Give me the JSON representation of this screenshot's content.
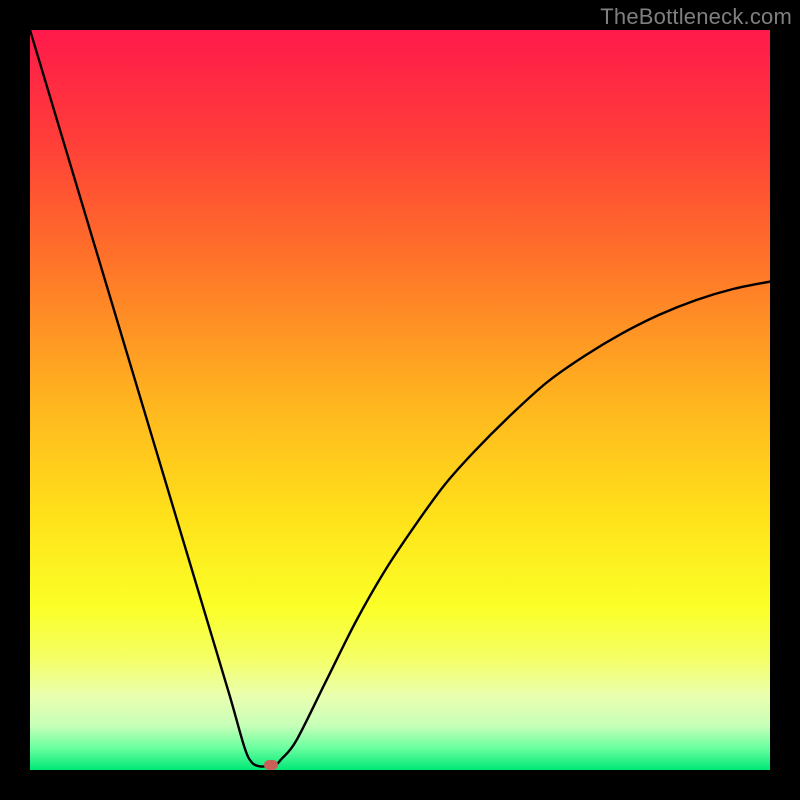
{
  "watermark": "TheBottleneck.com",
  "chart_data": {
    "type": "line",
    "title": "",
    "xlabel": "",
    "ylabel": "",
    "xlim": [
      0,
      100
    ],
    "ylim": [
      0,
      100
    ],
    "grid": false,
    "legend": false,
    "series": [
      {
        "name": "bottleneck-curve",
        "x": [
          0,
          3,
          6,
          9,
          12,
          15,
          18,
          21,
          24,
          27,
          29,
          30,
          31,
          32,
          33,
          34,
          36,
          40,
          44,
          48,
          52,
          56,
          60,
          65,
          70,
          75,
          80,
          85,
          90,
          95,
          100
        ],
        "y": [
          100,
          90,
          80,
          70,
          60,
          50,
          40,
          30,
          20,
          10,
          3,
          1,
          0.5,
          0.5,
          0.5,
          1.5,
          4,
          12,
          20,
          27,
          33,
          38.5,
          43,
          48,
          52.5,
          56,
          59,
          61.5,
          63.5,
          65,
          66
        ]
      }
    ],
    "marker": {
      "x": 32.5,
      "y": 0.7,
      "color": "#c86058"
    },
    "gradient_stops": [
      {
        "pct": 0,
        "color": "#ff1a4b"
      },
      {
        "pct": 14,
        "color": "#ff3b3a"
      },
      {
        "pct": 30,
        "color": "#ff6f2a"
      },
      {
        "pct": 50,
        "color": "#ffb41f"
      },
      {
        "pct": 66,
        "color": "#ffe21a"
      },
      {
        "pct": 78,
        "color": "#fbff27"
      },
      {
        "pct": 85,
        "color": "#f4ff66"
      },
      {
        "pct": 90,
        "color": "#eaffb0"
      },
      {
        "pct": 94,
        "color": "#c7ffb8"
      },
      {
        "pct": 97,
        "color": "#6bffa0"
      },
      {
        "pct": 100,
        "color": "#00e876"
      }
    ]
  }
}
